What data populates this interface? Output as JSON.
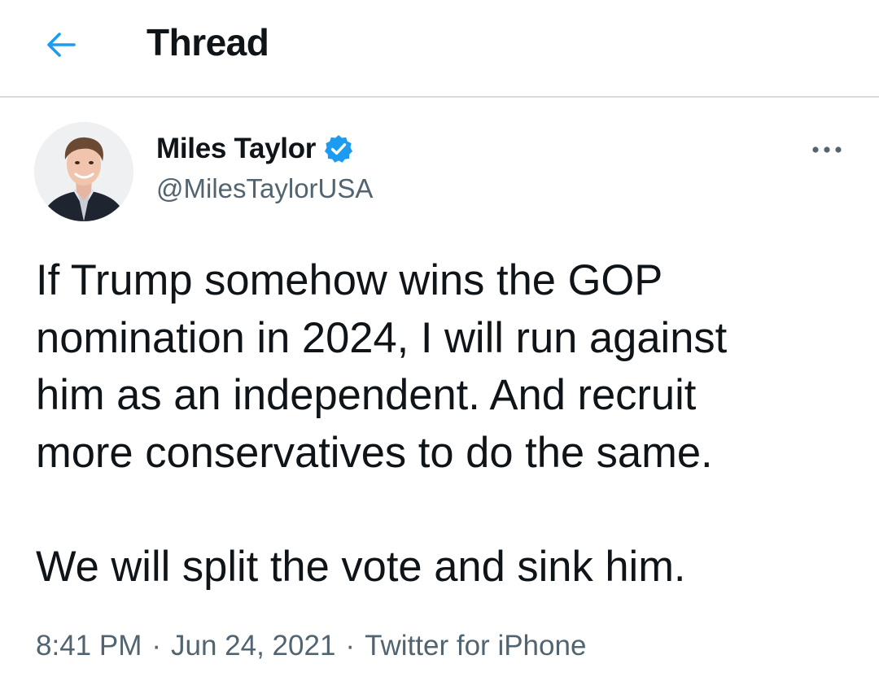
{
  "header": {
    "title": "Thread",
    "back_icon": "arrow-left-icon",
    "accent_color": "#1d9bf0"
  },
  "tweet": {
    "author": {
      "name": "Miles Taylor",
      "handle": "@MilesTaylorUSA",
      "verified": true,
      "verified_icon": "verified-badge-icon"
    },
    "more_icon": "more-horizontal-icon",
    "text_lines": [
      "If Trump somehow wins the GOP",
      "nomination in 2024, I will run against",
      "him as an independent. And recruit",
      "more conservatives to do the same."
    ],
    "text_line_last": "We will split the vote and sink him.",
    "time": "8:41 PM",
    "date": "Jun 24, 2021",
    "source": "Twitter for iPhone",
    "separator": "·"
  }
}
